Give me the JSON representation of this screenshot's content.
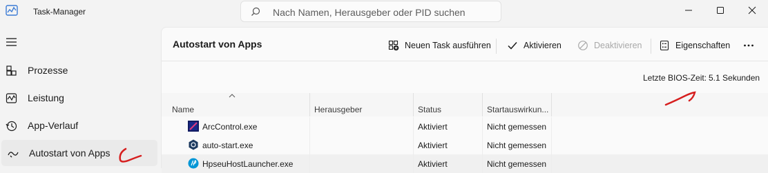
{
  "app": {
    "title": "Task-Manager",
    "search_placeholder": "Nach Namen, Herausgeber oder PID suchen",
    "accent_color": "#0067c0"
  },
  "window_controls": {
    "minimize": "minimize-icon",
    "maximize": "maximize-icon",
    "close": "close-icon"
  },
  "sidebar": {
    "menu_icon": "hamburger-icon",
    "items": [
      {
        "label": "Prozesse",
        "icon": "processes-icon",
        "active": false
      },
      {
        "label": "Leistung",
        "icon": "performance-icon",
        "active": false
      },
      {
        "label": "App-Verlauf",
        "icon": "history-icon",
        "active": false
      },
      {
        "label": "Autostart von Apps",
        "icon": "startup-icon",
        "active": true
      }
    ]
  },
  "toolbar": {
    "title": "Autostart von Apps",
    "run_new_task": "Neuen Task ausführen",
    "enable": "Aktivieren",
    "disable": "Deaktivieren",
    "properties": "Eigenschaften",
    "more": "more-icon"
  },
  "bios": {
    "label": "Letzte BIOS-Zeit:",
    "value": "5.1 Sekunden"
  },
  "table": {
    "columns": [
      "Name",
      "Herausgeber",
      "Status",
      "Startauswirkun..."
    ],
    "sort_column": "Name",
    "rows": [
      {
        "name": "ArcControl.exe",
        "publisher": "",
        "status": "Aktiviert",
        "impact": "Nicht gemessen",
        "icon": "arccontrol-icon"
      },
      {
        "name": "auto-start.exe",
        "publisher": "",
        "status": "Aktiviert",
        "impact": "Nicht gemessen",
        "icon": "autostart-app-icon"
      },
      {
        "name": "HpseuHostLauncher.exe",
        "publisher": "",
        "status": "Aktiviert",
        "impact": "Nicht gemessen",
        "icon": "hp-icon"
      }
    ]
  }
}
